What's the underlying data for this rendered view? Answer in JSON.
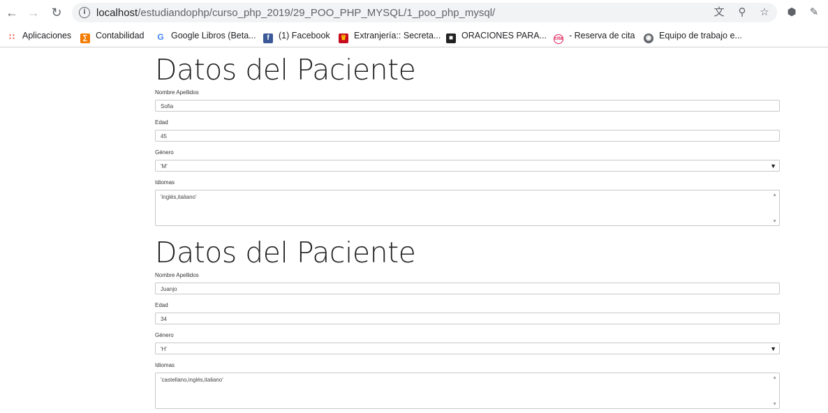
{
  "browser": {
    "url_host": "localhost",
    "url_path": "/estudiandophp/curso_php_2019/29_POO_PHP_MYSQL/1_poo_php_mysql/"
  },
  "bookmarks": [
    {
      "label": "Aplicaciones",
      "icon": "apps-grid-icon",
      "color": "#ea4335"
    },
    {
      "label": "Contabilidad",
      "icon": "xampp-icon",
      "color": "#f57c00"
    },
    {
      "label": "Google Libros (Beta...",
      "icon": "google-icon",
      "color": "#4285f4"
    },
    {
      "label": "(1) Facebook",
      "icon": "facebook-icon",
      "color": "#3b5998"
    },
    {
      "label": "Extranjería:: Secreta...",
      "icon": "spain-gov-icon",
      "color": "#c60b1e"
    },
    {
      "label": "ORACIONES PARA...",
      "icon": "book-icon",
      "color": "#222222"
    },
    {
      "label": "- Reserva de cita",
      "icon": "cita-icon",
      "color": "#e0245e"
    },
    {
      "label": "Equipo de trabajo e...",
      "icon": "globe-icon",
      "color": "#5f6368"
    }
  ],
  "patients": [
    {
      "title": "Datos del Paciente",
      "name_label": "Nombre Apellidos",
      "name_value": "Sofia",
      "age_label": "Edad",
      "age_value": "45",
      "gender_label": "Género",
      "gender_value": "'M'",
      "languages_label": "Idiomas",
      "languages_value": "'inglés,italiano'"
    },
    {
      "title": "Datos del Paciente",
      "name_label": "Nombre Apellidos",
      "name_value": "Juanjo",
      "age_label": "Edad",
      "age_value": "34",
      "gender_label": "Género",
      "gender_value": "'H'",
      "languages_label": "Idiomas",
      "languages_value": "'castellano,inglés,italiano'"
    }
  ]
}
